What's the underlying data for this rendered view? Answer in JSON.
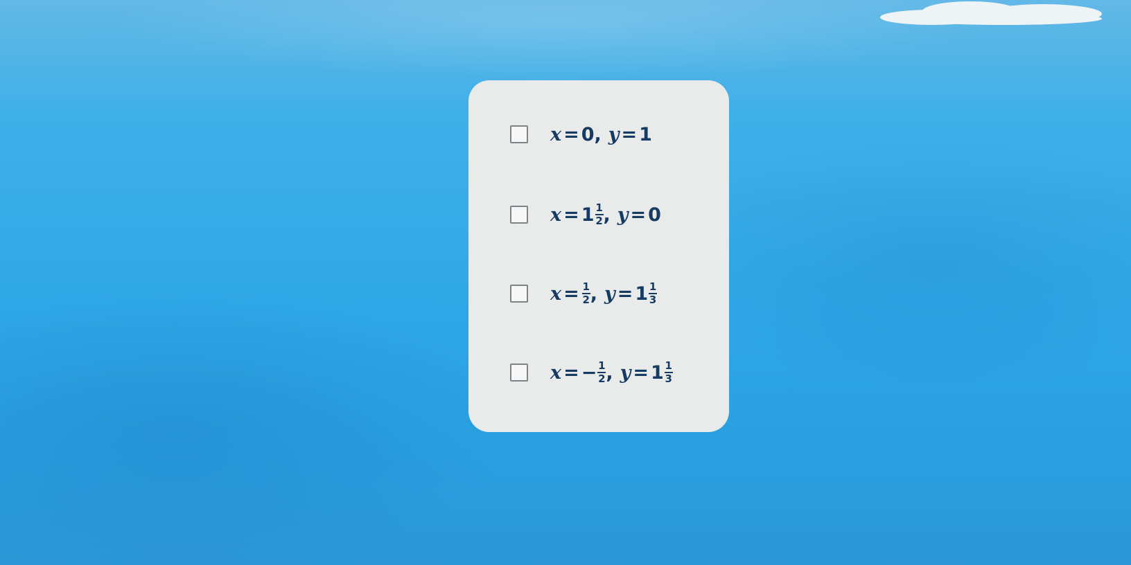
{
  "options": [
    {
      "x": {
        "sign": "",
        "whole": "0",
        "num": "",
        "den": ""
      },
      "comma": ",",
      "y": {
        "sign": "",
        "whole": "1",
        "num": "",
        "den": ""
      }
    },
    {
      "x": {
        "sign": "",
        "whole": "1",
        "num": "1",
        "den": "2"
      },
      "comma": ",",
      "y": {
        "sign": "",
        "whole": "0",
        "num": "",
        "den": ""
      }
    },
    {
      "x": {
        "sign": "",
        "whole": "",
        "num": "1",
        "den": "2"
      },
      "comma": ",",
      "y": {
        "sign": "",
        "whole": "1",
        "num": "1",
        "den": "3"
      }
    },
    {
      "x": {
        "sign": "−",
        "whole": "",
        "num": "1",
        "den": "2"
      },
      "comma": ",",
      "y": {
        "sign": "",
        "whole": "1",
        "num": "1",
        "den": "3"
      }
    }
  ],
  "labels": {
    "x_var": "x",
    "y_var": "y",
    "equals": "="
  },
  "colors": {
    "card": "#e9eaea",
    "text": "#163b63",
    "checkbox_border": "#7d8386",
    "sky": "#2fa7e6"
  },
  "checked": [
    false,
    false,
    false,
    false
  ]
}
